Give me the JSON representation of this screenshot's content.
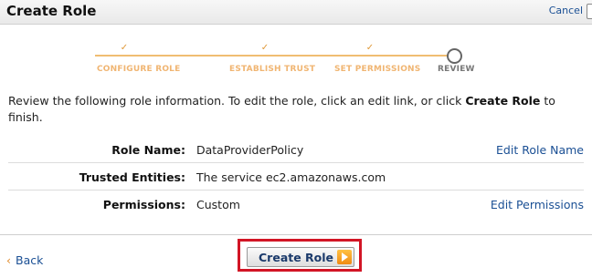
{
  "header": {
    "title": "Create Role",
    "cancel_label": "Cancel"
  },
  "steps": [
    {
      "label": "CONFIGURE ROLE",
      "status": "completed"
    },
    {
      "label": "ESTABLISH TRUST",
      "status": "completed"
    },
    {
      "label": "SET PERMISSIONS",
      "status": "completed"
    },
    {
      "label": "REVIEW",
      "status": "current"
    }
  ],
  "intro": {
    "text_before": "Review the following role information. To edit the role, click an edit link, or click ",
    "emphasis": "Create Role",
    "text_after": " to finish."
  },
  "review": {
    "role_name": {
      "label": "Role Name:",
      "value": "DataProviderPolicy",
      "edit": "Edit Role Name"
    },
    "trusted_entities": {
      "label": "Trusted Entities:",
      "value": "The service ec2.amazonaws.com"
    },
    "permissions": {
      "label": "Permissions:",
      "value": "Custom",
      "edit": "Edit Permissions"
    }
  },
  "footer": {
    "back_arrow": "‹",
    "back_label": "Back",
    "create_label": "Create Role"
  },
  "colors": {
    "link": "#1a4f94",
    "step_complete": "#f0b572",
    "highlight": "#d21525",
    "button_icon": "#f08a12"
  }
}
